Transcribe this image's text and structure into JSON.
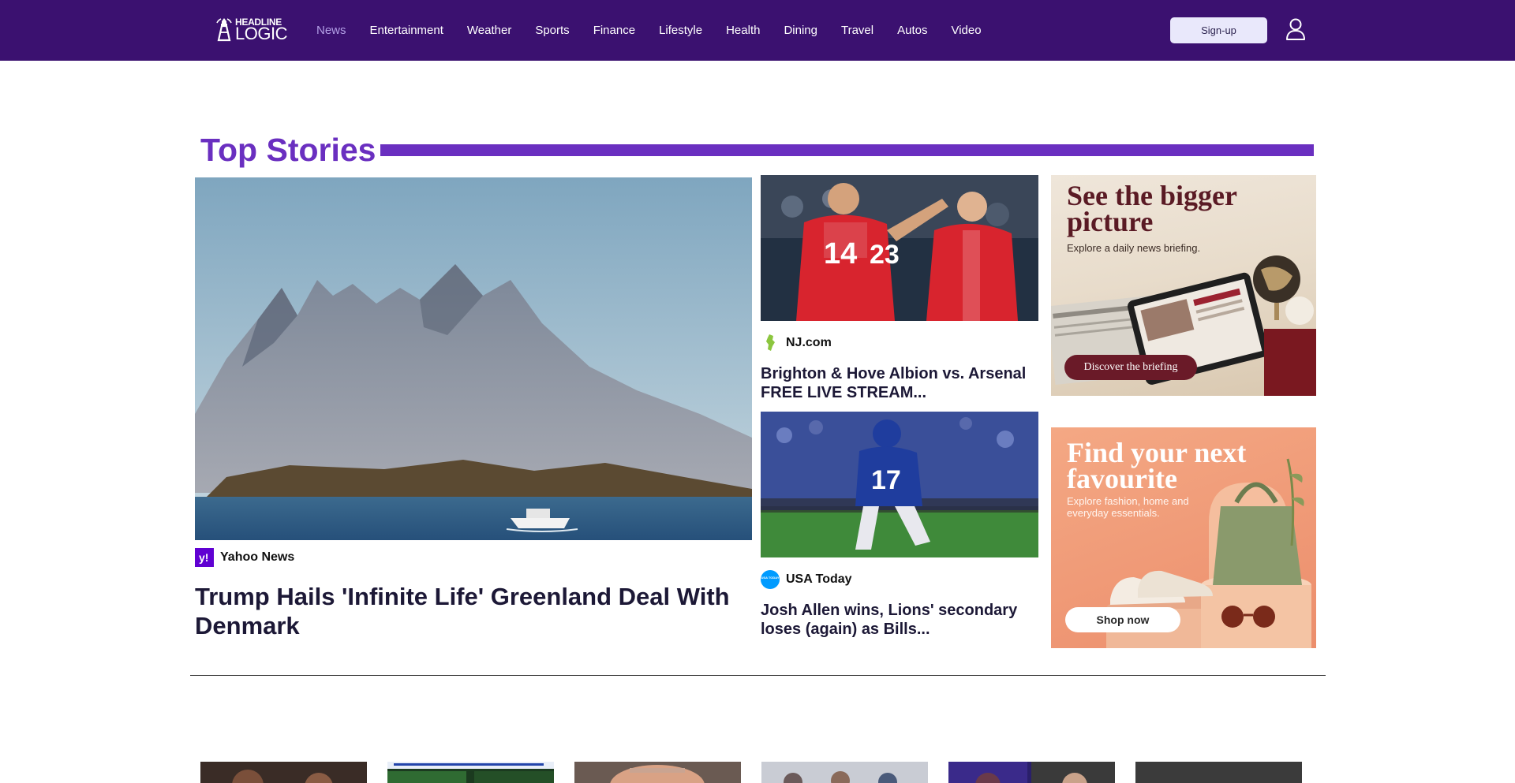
{
  "brand": {
    "logo_line1": "HEADLINE",
    "logo_line2": "LOGIC"
  },
  "nav": {
    "items": [
      "News",
      "Entertainment",
      "Weather",
      "Sports",
      "Finance",
      "Lifestyle",
      "Health",
      "Dining",
      "Travel",
      "Autos",
      "Video"
    ],
    "active": "News",
    "signup_label": "Sign-up"
  },
  "section": {
    "title": "Top Stories"
  },
  "stories": {
    "main": {
      "source": "Yahoo News",
      "title": "Trump Hails 'Infinite Life' Greenland Deal With Denmark"
    },
    "side": [
      {
        "source": "NJ.com",
        "title": "Brighton & Hove Albion vs. Arsenal FREE LIVE STREAM...",
        "jersey_left": "14",
        "jersey_mid": "23"
      },
      {
        "source": "USA Today",
        "badge_text": "USA TODAY",
        "title": "Josh Allen wins, Lions' secondary loses (again) as Bills...",
        "jersey": "17"
      }
    ]
  },
  "ads": [
    {
      "headline_1": "See the bigger",
      "headline_2": "picture",
      "subtext": "Explore a daily news briefing.",
      "button": "Discover the briefing"
    },
    {
      "headline_1": "Find your next",
      "headline_2": "favourite",
      "subtext_1": "Explore fashion, home and",
      "subtext_2": "everyday essentials.",
      "button": "Shop now"
    }
  ],
  "colors": {
    "header_bg": "#3b1170",
    "accent": "#6a2fc0",
    "active_nav": "#b3a0e6",
    "ad2_bg": "#f09b78"
  },
  "icons": {
    "user": "user-icon",
    "yahoo": "yahoo-logo-icon",
    "nj": "nj-state-icon",
    "usatoday": "usa-today-icon"
  }
}
